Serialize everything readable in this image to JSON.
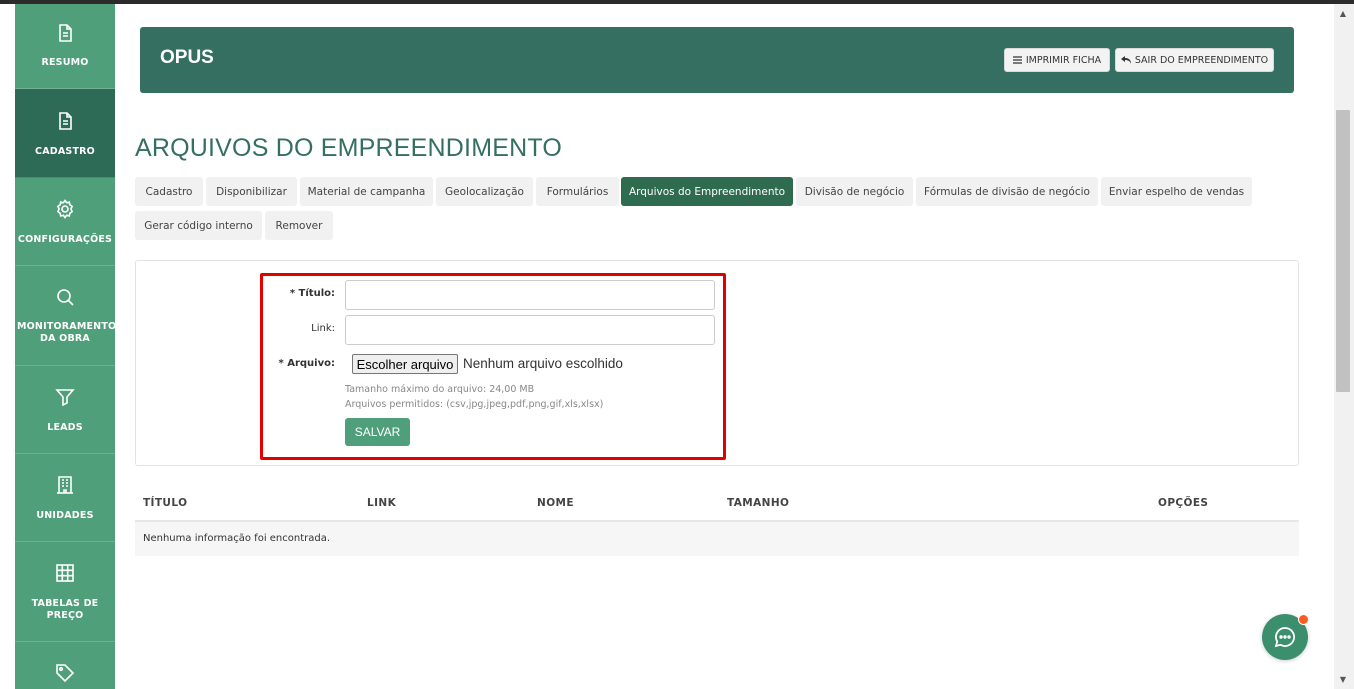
{
  "sidebar": {
    "items": [
      {
        "label": "RESUMO",
        "icon": "document-icon"
      },
      {
        "label": "CADASTRO",
        "icon": "document-icon",
        "active": true
      },
      {
        "label": "CONFIGURAÇÕES",
        "icon": "gear-icon"
      },
      {
        "label": "MONITORAMENTO DA OBRA",
        "icon": "search-icon"
      },
      {
        "label": "LEADS",
        "icon": "funnel-icon"
      },
      {
        "label": "UNIDADES",
        "icon": "building-icon"
      },
      {
        "label": "TABELAS DE PREÇO",
        "icon": "grid-icon"
      },
      {
        "label": "",
        "icon": "tag-icon"
      }
    ]
  },
  "header": {
    "title": "OPUS",
    "print_button": "IMPRIMIR FICHA",
    "exit_button": "SAIR DO EMPREENDIMENTO"
  },
  "page": {
    "title": "ARQUIVOS DO EMPREENDIMENTO"
  },
  "tabs": [
    {
      "label": "Cadastro"
    },
    {
      "label": "Disponibilizar"
    },
    {
      "label": "Material de campanha"
    },
    {
      "label": "Geolocalização"
    },
    {
      "label": "Formulários"
    },
    {
      "label": "Arquivos do Empreendimento",
      "active": true
    },
    {
      "label": "Divisão de negócio"
    },
    {
      "label": "Fórmulas de divisão de negócio"
    },
    {
      "label": "Enviar espelho de vendas"
    },
    {
      "label": "Gerar código interno"
    },
    {
      "label": "Remover"
    }
  ],
  "form": {
    "title_label": "* Título:",
    "title_value": "",
    "link_label": "Link:",
    "link_value": "",
    "file_label": "* Arquivo:",
    "file_button": "Escolher arquivo",
    "file_status": "Nenhum arquivo escolhido",
    "hint_size": "Tamanho máximo do arquivo: 24,00 MB",
    "hint_types": "Arquivos permitidos: (csv,jpg,jpeg,pdf,png,gif,xls,xlsx)",
    "save_button": "SALVAR"
  },
  "table": {
    "columns": [
      "TÍTULO",
      "LINK",
      "NOME",
      "TAMANHO",
      "OPÇÕES"
    ],
    "empty_message": "Nenhuma informação foi encontrada."
  },
  "colors": {
    "sidebar": "#4f9f7a",
    "sidebar_active": "#2e6b56",
    "header": "#356f61",
    "tab_active": "#2e6b4f",
    "highlight": "#e50000",
    "chat_badge": "#ff5a1f"
  }
}
